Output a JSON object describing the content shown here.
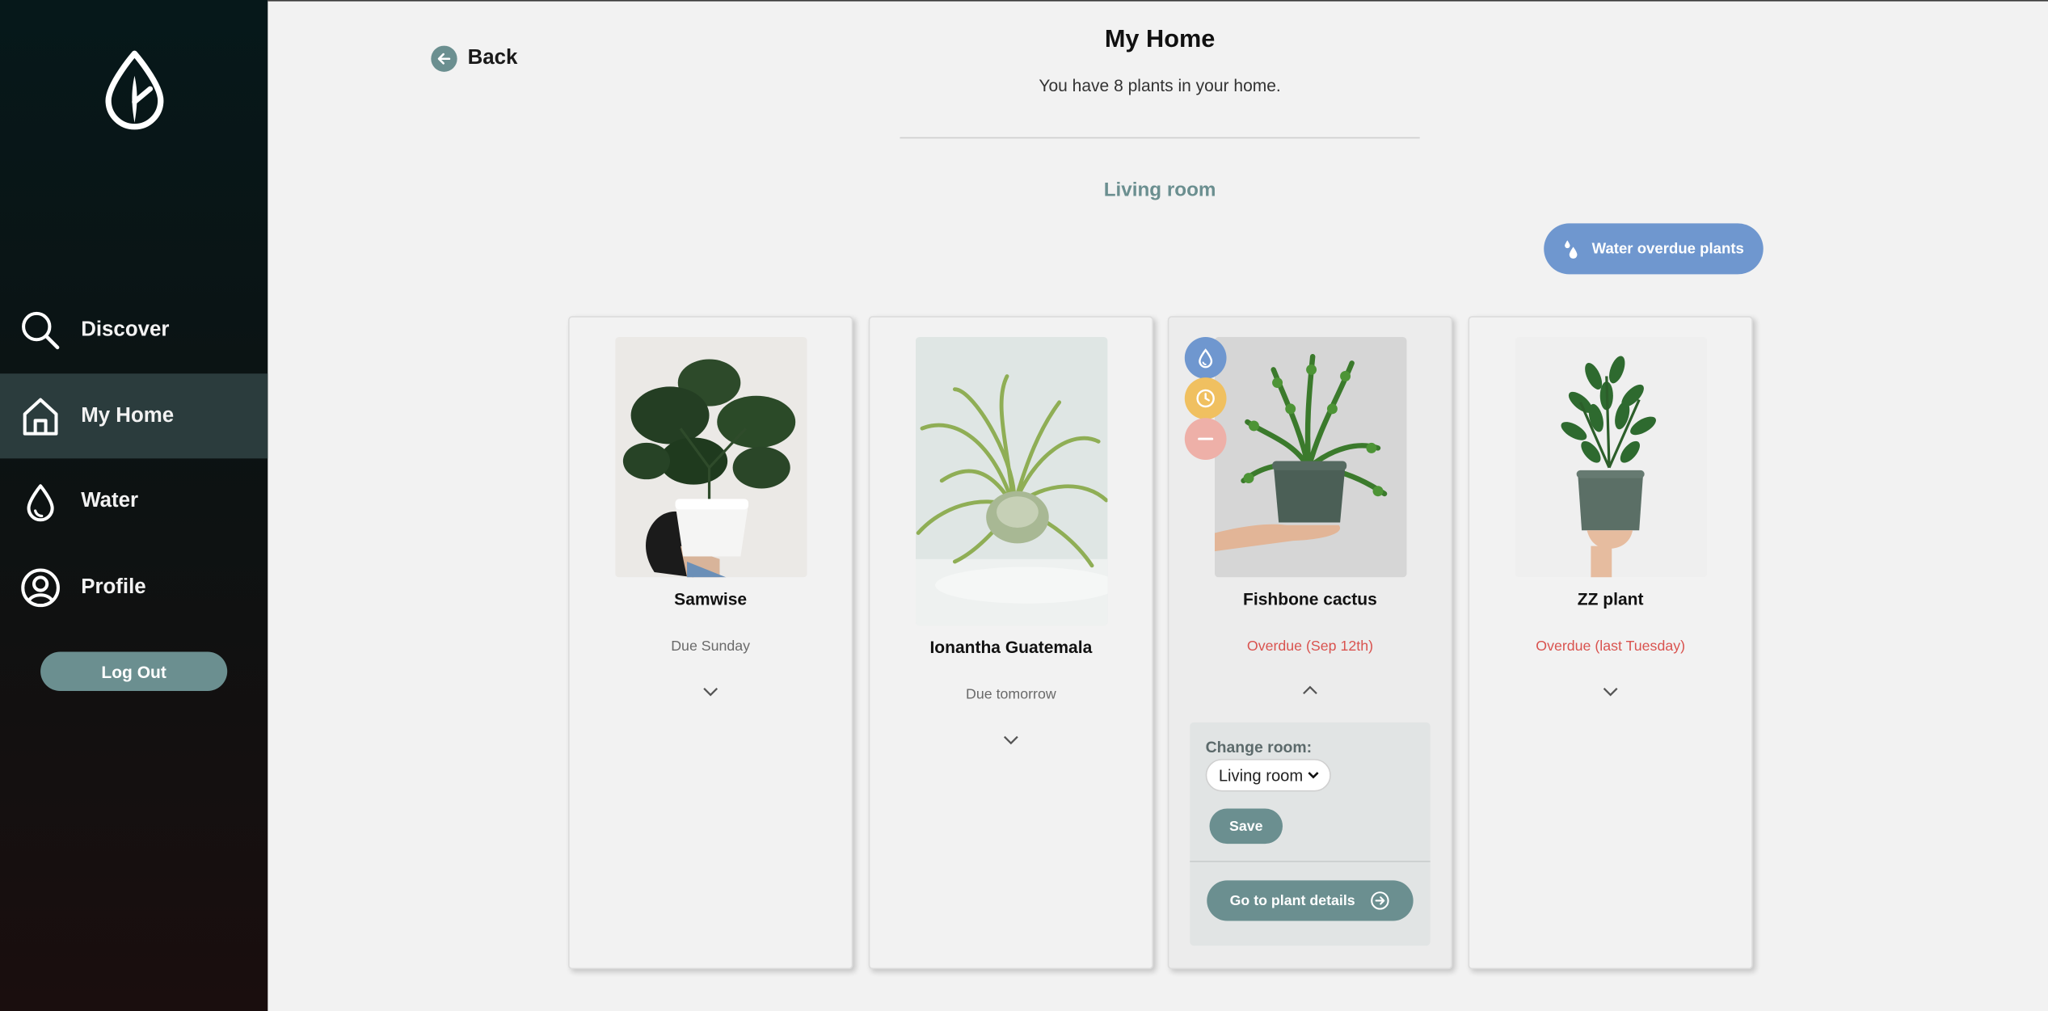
{
  "sidebar": {
    "logo_icon": "leaf-drop-icon",
    "items": [
      {
        "label": "Discover",
        "icon": "search-icon",
        "active": false
      },
      {
        "label": "My Home",
        "icon": "home-icon",
        "active": true
      },
      {
        "label": "Water",
        "icon": "water-drop-icon",
        "active": false
      },
      {
        "label": "Profile",
        "icon": "user-icon",
        "active": false
      }
    ],
    "logout_label": "Log Out"
  },
  "header": {
    "back_label": "Back",
    "title": "My Home",
    "subtitle": "You have 8 plants in your home."
  },
  "room": {
    "name": "Living room",
    "water_overdue_label": "Water overdue plants"
  },
  "plants": [
    {
      "name": "Samwise",
      "due": "Due Sunday",
      "overdue": false,
      "expanded": false
    },
    {
      "name": "Ionantha Guatemala",
      "due": "Due tomorrow",
      "overdue": false,
      "expanded": false
    },
    {
      "name": "Fishbone cactus",
      "due": "Overdue (Sep 12th)",
      "overdue": true,
      "expanded": true
    },
    {
      "name": "ZZ plant",
      "due": "Overdue (last Tuesday)",
      "overdue": true,
      "expanded": false
    }
  ],
  "expanded_panel": {
    "change_room_label": "Change room:",
    "selected_room": "Living room",
    "save_label": "Save",
    "details_label": "Go to plant details"
  },
  "colors": {
    "accent": "#6b8f90",
    "water_blue": "#6f97cf",
    "snooze_yellow": "#f0c060",
    "remove_pink": "#eeb0a8",
    "overdue_red": "#d9534f"
  }
}
